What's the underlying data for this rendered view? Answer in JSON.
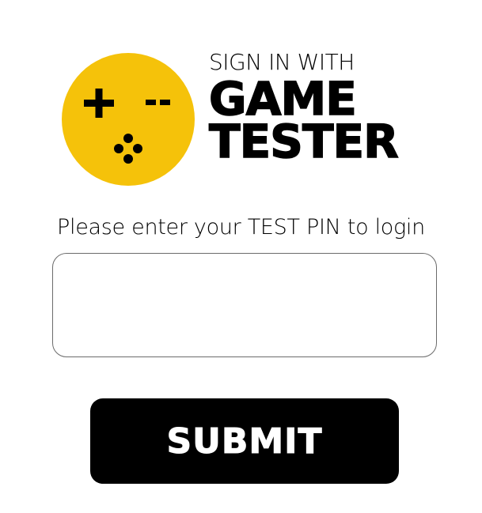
{
  "logo": {
    "icon": "gamepad-face-icon",
    "color": "#F5C20A"
  },
  "header": {
    "subtitle": "SIGN IN WITH",
    "title_line1": "GAME",
    "title_line2": "TESTER"
  },
  "form": {
    "prompt": "Please enter your TEST PIN to login",
    "pin_value": "",
    "pin_placeholder": "",
    "submit_label": "SUBMIT"
  },
  "colors": {
    "accent": "#F5C20A",
    "button_bg": "#000000",
    "button_text": "#FFFFFF",
    "input_border": "#6B6B6B"
  }
}
